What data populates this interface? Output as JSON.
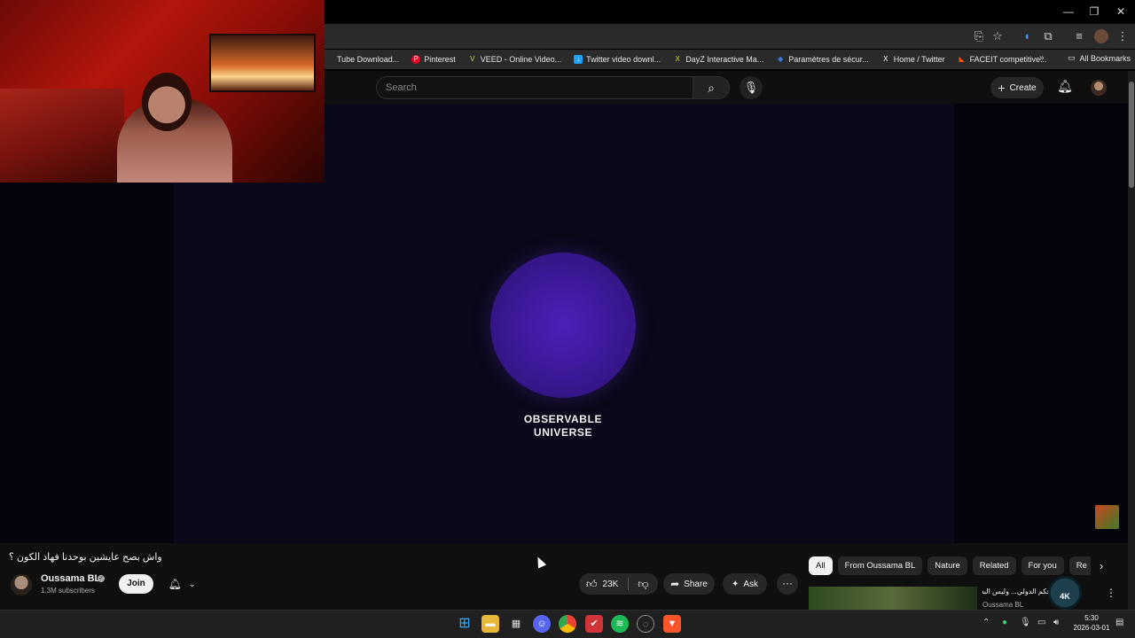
{
  "window": {
    "minimize": "—",
    "restore": "❐",
    "close": "✕"
  },
  "bookmarks": [
    {
      "label": "Tube Download...",
      "icon": "download-icon",
      "color": "#3a3a3a"
    },
    {
      "label": "Pinterest",
      "icon": "pinterest-icon",
      "color": "#e60023"
    },
    {
      "label": "VEED - Online Video...",
      "icon": "veed-icon",
      "color": "#b7e34a"
    },
    {
      "label": "Twitter video downl...",
      "icon": "twitter-download-icon",
      "color": "#1da1f2"
    },
    {
      "label": "DayZ Interactive Ma...",
      "icon": "dayz-icon",
      "color": "#3a3a3a"
    },
    {
      "label": "Paramètres de sécur...",
      "icon": "security-icon",
      "color": "#3b7ddd"
    },
    {
      "label": "Home / Twitter",
      "icon": "x-icon",
      "color": "#000000"
    },
    {
      "label": "FACEIT competitive...",
      "icon": "faceit-icon",
      "color": "#ff5500"
    }
  ],
  "all_bookmarks": "All Bookmarks",
  "header": {
    "search_placeholder": "Search",
    "create_label": "Create"
  },
  "video": {
    "overlay_line1": "OBSERVABLE",
    "overlay_line2": "UNIVERSE",
    "title": "واش بصح عايشين بوحدنا فهاد الكون ؟"
  },
  "channel": {
    "name": "Oussama BL",
    "subscribers": "1.3M subscribers",
    "join_label": "Join"
  },
  "actions": {
    "likes": "23K",
    "share": "Share",
    "ask": "Ask"
  },
  "chips": [
    "All",
    "From Oussama BL",
    "Nature",
    "Related",
    "For you",
    "Re"
  ],
  "sidebar_video": {
    "title": "تحكم الدولي... وليس البشر !",
    "channel": "Oussama BL",
    "badge": "4K"
  },
  "clock": {
    "time": "5:30",
    "date": "2026-03-01"
  },
  "colors": {
    "accent_red": "#ff0000",
    "orb": "#3a1893",
    "chip_active": "#f1f1f1"
  }
}
